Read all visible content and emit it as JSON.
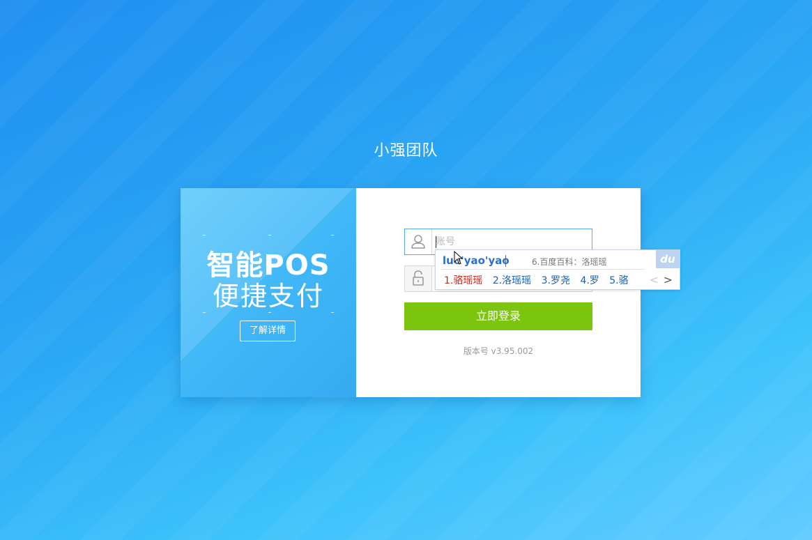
{
  "brand": {
    "title": "小强团队"
  },
  "promo": {
    "line1": "智能POS",
    "line2": "便捷支付",
    "details_button": "了解详情"
  },
  "login": {
    "account_placeholder": "账号",
    "account_value": "",
    "password_value": "",
    "submit_label": "立即登录",
    "version": "版本号 v3.95.002"
  },
  "ime": {
    "pinyin": "luo'yao'yao",
    "hint": "6.百度百科：洛瑶瑶",
    "logo": "du",
    "candidates": [
      "1.骆瑶瑶",
      "2.洛瑶瑶",
      "3.罗尧",
      "4.罗",
      "5.骆"
    ],
    "prev": "<",
    "next": ">"
  },
  "colors": {
    "login_button": "#7cc50f",
    "focus_border": "#5aa7ee",
    "pinyin": "#2a6fd1",
    "first_candidate": "#d0281c"
  }
}
